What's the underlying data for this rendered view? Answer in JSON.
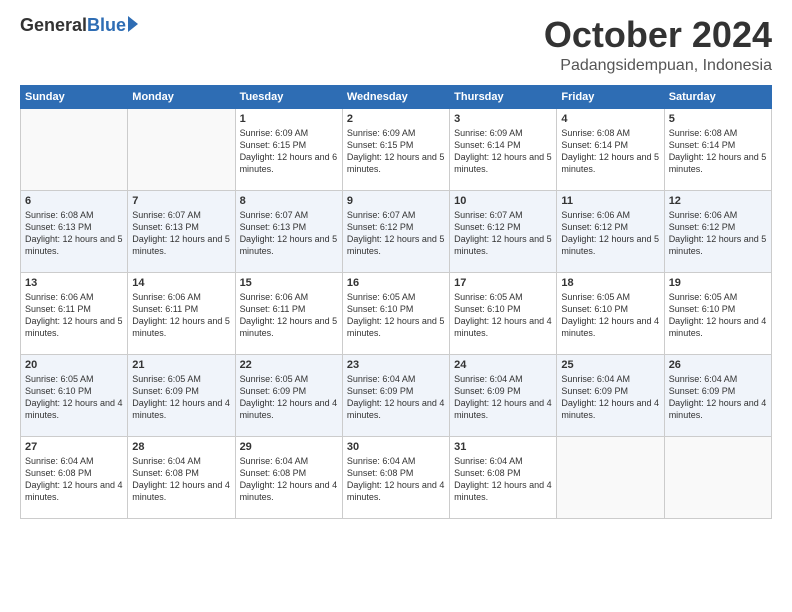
{
  "logo": {
    "general": "General",
    "blue": "Blue"
  },
  "header": {
    "month": "October 2024",
    "location": "Padangsidempuan, Indonesia"
  },
  "weekdays": [
    "Sunday",
    "Monday",
    "Tuesday",
    "Wednesday",
    "Thursday",
    "Friday",
    "Saturday"
  ],
  "weeks": [
    [
      {
        "day": "",
        "empty": true
      },
      {
        "day": "",
        "empty": true
      },
      {
        "day": "1",
        "sunrise": "Sunrise: 6:09 AM",
        "sunset": "Sunset: 6:15 PM",
        "daylight": "Daylight: 12 hours and 6 minutes."
      },
      {
        "day": "2",
        "sunrise": "Sunrise: 6:09 AM",
        "sunset": "Sunset: 6:15 PM",
        "daylight": "Daylight: 12 hours and 5 minutes."
      },
      {
        "day": "3",
        "sunrise": "Sunrise: 6:09 AM",
        "sunset": "Sunset: 6:14 PM",
        "daylight": "Daylight: 12 hours and 5 minutes."
      },
      {
        "day": "4",
        "sunrise": "Sunrise: 6:08 AM",
        "sunset": "Sunset: 6:14 PM",
        "daylight": "Daylight: 12 hours and 5 minutes."
      },
      {
        "day": "5",
        "sunrise": "Sunrise: 6:08 AM",
        "sunset": "Sunset: 6:14 PM",
        "daylight": "Daylight: 12 hours and 5 minutes."
      }
    ],
    [
      {
        "day": "6",
        "sunrise": "Sunrise: 6:08 AM",
        "sunset": "Sunset: 6:13 PM",
        "daylight": "Daylight: 12 hours and 5 minutes."
      },
      {
        "day": "7",
        "sunrise": "Sunrise: 6:07 AM",
        "sunset": "Sunset: 6:13 PM",
        "daylight": "Daylight: 12 hours and 5 minutes."
      },
      {
        "day": "8",
        "sunrise": "Sunrise: 6:07 AM",
        "sunset": "Sunset: 6:13 PM",
        "daylight": "Daylight: 12 hours and 5 minutes."
      },
      {
        "day": "9",
        "sunrise": "Sunrise: 6:07 AM",
        "sunset": "Sunset: 6:12 PM",
        "daylight": "Daylight: 12 hours and 5 minutes."
      },
      {
        "day": "10",
        "sunrise": "Sunrise: 6:07 AM",
        "sunset": "Sunset: 6:12 PM",
        "daylight": "Daylight: 12 hours and 5 minutes."
      },
      {
        "day": "11",
        "sunrise": "Sunrise: 6:06 AM",
        "sunset": "Sunset: 6:12 PM",
        "daylight": "Daylight: 12 hours and 5 minutes."
      },
      {
        "day": "12",
        "sunrise": "Sunrise: 6:06 AM",
        "sunset": "Sunset: 6:12 PM",
        "daylight": "Daylight: 12 hours and 5 minutes."
      }
    ],
    [
      {
        "day": "13",
        "sunrise": "Sunrise: 6:06 AM",
        "sunset": "Sunset: 6:11 PM",
        "daylight": "Daylight: 12 hours and 5 minutes."
      },
      {
        "day": "14",
        "sunrise": "Sunrise: 6:06 AM",
        "sunset": "Sunset: 6:11 PM",
        "daylight": "Daylight: 12 hours and 5 minutes."
      },
      {
        "day": "15",
        "sunrise": "Sunrise: 6:06 AM",
        "sunset": "Sunset: 6:11 PM",
        "daylight": "Daylight: 12 hours and 5 minutes."
      },
      {
        "day": "16",
        "sunrise": "Sunrise: 6:05 AM",
        "sunset": "Sunset: 6:10 PM",
        "daylight": "Daylight: 12 hours and 5 minutes."
      },
      {
        "day": "17",
        "sunrise": "Sunrise: 6:05 AM",
        "sunset": "Sunset: 6:10 PM",
        "daylight": "Daylight: 12 hours and 4 minutes."
      },
      {
        "day": "18",
        "sunrise": "Sunrise: 6:05 AM",
        "sunset": "Sunset: 6:10 PM",
        "daylight": "Daylight: 12 hours and 4 minutes."
      },
      {
        "day": "19",
        "sunrise": "Sunrise: 6:05 AM",
        "sunset": "Sunset: 6:10 PM",
        "daylight": "Daylight: 12 hours and 4 minutes."
      }
    ],
    [
      {
        "day": "20",
        "sunrise": "Sunrise: 6:05 AM",
        "sunset": "Sunset: 6:10 PM",
        "daylight": "Daylight: 12 hours and 4 minutes."
      },
      {
        "day": "21",
        "sunrise": "Sunrise: 6:05 AM",
        "sunset": "Sunset: 6:09 PM",
        "daylight": "Daylight: 12 hours and 4 minutes."
      },
      {
        "day": "22",
        "sunrise": "Sunrise: 6:05 AM",
        "sunset": "Sunset: 6:09 PM",
        "daylight": "Daylight: 12 hours and 4 minutes."
      },
      {
        "day": "23",
        "sunrise": "Sunrise: 6:04 AM",
        "sunset": "Sunset: 6:09 PM",
        "daylight": "Daylight: 12 hours and 4 minutes."
      },
      {
        "day": "24",
        "sunrise": "Sunrise: 6:04 AM",
        "sunset": "Sunset: 6:09 PM",
        "daylight": "Daylight: 12 hours and 4 minutes."
      },
      {
        "day": "25",
        "sunrise": "Sunrise: 6:04 AM",
        "sunset": "Sunset: 6:09 PM",
        "daylight": "Daylight: 12 hours and 4 minutes."
      },
      {
        "day": "26",
        "sunrise": "Sunrise: 6:04 AM",
        "sunset": "Sunset: 6:09 PM",
        "daylight": "Daylight: 12 hours and 4 minutes."
      }
    ],
    [
      {
        "day": "27",
        "sunrise": "Sunrise: 6:04 AM",
        "sunset": "Sunset: 6:08 PM",
        "daylight": "Daylight: 12 hours and 4 minutes."
      },
      {
        "day": "28",
        "sunrise": "Sunrise: 6:04 AM",
        "sunset": "Sunset: 6:08 PM",
        "daylight": "Daylight: 12 hours and 4 minutes."
      },
      {
        "day": "29",
        "sunrise": "Sunrise: 6:04 AM",
        "sunset": "Sunset: 6:08 PM",
        "daylight": "Daylight: 12 hours and 4 minutes."
      },
      {
        "day": "30",
        "sunrise": "Sunrise: 6:04 AM",
        "sunset": "Sunset: 6:08 PM",
        "daylight": "Daylight: 12 hours and 4 minutes."
      },
      {
        "day": "31",
        "sunrise": "Sunrise: 6:04 AM",
        "sunset": "Sunset: 6:08 PM",
        "daylight": "Daylight: 12 hours and 4 minutes."
      },
      {
        "day": "",
        "empty": true
      },
      {
        "day": "",
        "empty": true
      }
    ]
  ]
}
